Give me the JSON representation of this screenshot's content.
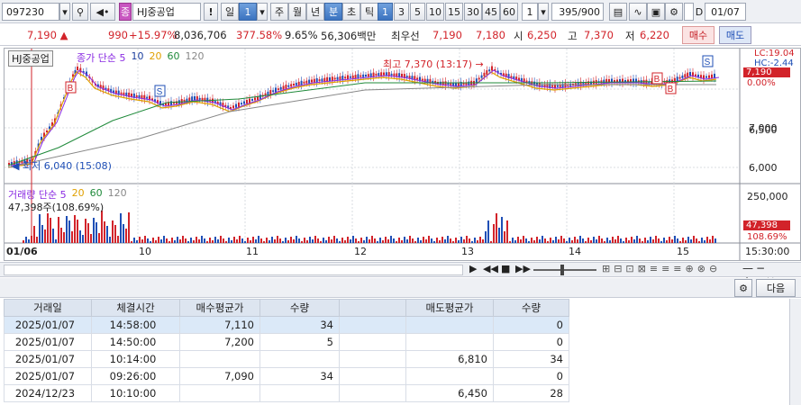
{
  "toolbar": {
    "code": "097230",
    "name_tag": "종",
    "name": "HJ중공업",
    "period_buttons": [
      "일",
      "주",
      "월",
      "년",
      "분",
      "초",
      "틱"
    ],
    "active_period_num": "1",
    "minute_steps": [
      "1",
      "3",
      "5",
      "10",
      "15",
      "30",
      "45",
      "60"
    ],
    "interval": "1",
    "count": "395/900",
    "checkbox_label": "D",
    "date": "01/07"
  },
  "quote": {
    "price": "7,190",
    "change": "990",
    "rate": "+15.97%",
    "volume": "8,036,706",
    "vol_rate": "377.58%",
    "turnover": "9.65%",
    "amount": "56,306백만",
    "priority_label": "최우선",
    "ask": "7,190",
    "bid": "7,180",
    "open_label": "시",
    "open": "6,250",
    "high_label": "고",
    "high": "7,370",
    "low_label": "저",
    "low": "6,220",
    "buy_label": "매수",
    "sell_label": "매도"
  },
  "chart": {
    "legend_name": "HJ중공업",
    "legend_items": [
      "종가 단순 5",
      "10",
      "20",
      "60",
      "120"
    ],
    "high_annotation": "최고 7,370 (13:17)",
    "low_annotation": "최저 6,040 (15:08)",
    "lc": "LC:19.04",
    "hc": "HC:-2.44",
    "price_tag": "7,190",
    "pct_tag": "0.00%",
    "y_labels": [
      "7,000",
      "6,500",
      "6,000"
    ],
    "vol_legend": [
      "거래량 단순 5",
      "20",
      "60",
      "120"
    ],
    "vol_now": "47,398주(108.69%)",
    "vol_max": "250,000",
    "vol_tag": "47,398",
    "vol_pct": "108.69%",
    "dates": [
      "01/06",
      "10",
      "11",
      "12",
      "13",
      "14",
      "15"
    ],
    "time": "15:30:00",
    "markers": [
      "B",
      "S",
      "B",
      "B",
      "S"
    ]
  },
  "table": {
    "headers": [
      "거래일",
      "체결시간",
      "매수평균가",
      "수량",
      "",
      "매도평균가",
      "수량"
    ],
    "next_button": "다음",
    "rows": [
      [
        "2025/01/07",
        "14:58:00",
        "7,110",
        "34",
        "",
        "",
        "0"
      ],
      [
        "2025/01/07",
        "14:50:00",
        "7,200",
        "5",
        "",
        "",
        "0"
      ],
      [
        "2025/01/07",
        "10:14:00",
        "",
        "",
        "",
        "6,810",
        "34"
      ],
      [
        "2025/01/07",
        "09:26:00",
        "7,090",
        "34",
        "",
        "",
        "0"
      ],
      [
        "2024/12/23",
        "10:10:00",
        "",
        "",
        "",
        "6,450",
        "28"
      ]
    ]
  },
  "colors": {
    "up": "#d2232a",
    "down": "#1f4fb6",
    "ma5": "#8a2be2",
    "ma10": "#1c3f9e",
    "ma20": "#e0a000",
    "ma60": "#1f8a3a",
    "ma120": "#888888"
  }
}
